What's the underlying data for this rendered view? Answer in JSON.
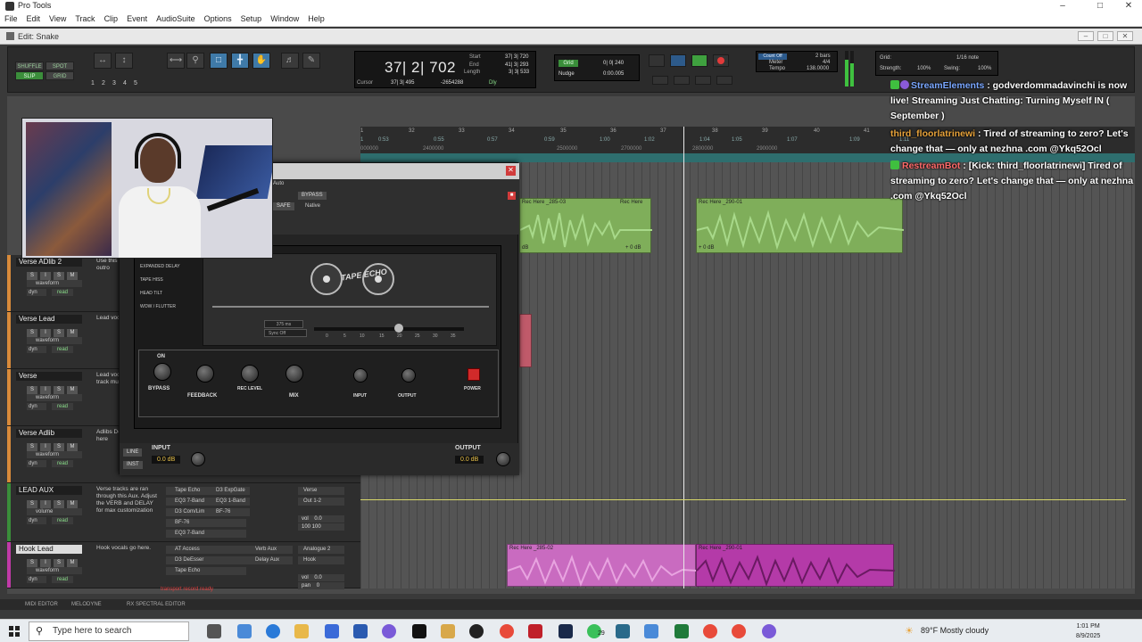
{
  "window": {
    "title": "Pro Tools",
    "edit_title": "Edit: Snake"
  },
  "menu": [
    "File",
    "Edit",
    "View",
    "Track",
    "Clip",
    "Event",
    "AudioSuite",
    "Options",
    "Setup",
    "Window",
    "Help"
  ],
  "toolbar": {
    "modes": [
      "SHUFFLE",
      "SPOT",
      "SLIP",
      "GRID"
    ],
    "zoom_presets": [
      "1",
      "2",
      "3",
      "4",
      "5"
    ],
    "main_counter": "37| 2| 702",
    "start_label": "Start",
    "start_value": "37| 3| 720",
    "end_label": "End",
    "end_value": "41| 3| 293",
    "length_label": "Length",
    "length_value": "3| 3| 533",
    "cursor_label": "Cursor",
    "cursor_value": "37| 3| 495",
    "cursor_sample": "-2654288",
    "dly_label": "Dly",
    "grid_label": "Grid",
    "grid_value": "0| 0| 240",
    "nudge_label": "Nudge",
    "nudge_value": "0:00.005",
    "count_off": "Count Off",
    "bars": "2 bars",
    "meter_label": "Meter",
    "meter_value": "4/4",
    "tempo_label": "Tempo",
    "tempo_value": "138.0000",
    "grid_panel_label": "Grid:",
    "grid_panel_value": "1/16 note",
    "strength_label": "Strength:",
    "strength_value": "100%",
    "swing_label": "Swing:",
    "swing_value": "100%"
  },
  "ruler": {
    "bars": [
      "1",
      "32",
      "33",
      "34",
      "35",
      "36",
      "37",
      "38",
      "39",
      "40",
      "41"
    ],
    "mins": [
      "1",
      "0:53",
      "0:55",
      "0:57",
      "0:59",
      "1:00",
      "1:02",
      "1:04",
      "1:05",
      "1:07",
      "1:09",
      "1:11"
    ],
    "samples": [
      "000000",
      "2400000",
      "2500000",
      "2700000",
      "2800000",
      "2900000"
    ]
  },
  "tracks": [
    {
      "name": "Verse ADlib 2",
      "buttons": [
        "S",
        "I",
        "S",
        "M"
      ],
      "view": "waveform",
      "dyn": "dyn",
      "mode": "read",
      "comment": "Use this filter for the outro",
      "color": "#d88a3a"
    },
    {
      "name": "Verse Lead",
      "buttons": [
        "S",
        "I",
        "S",
        "M"
      ],
      "view": "waveform",
      "dyn": "dyn",
      "mode": "read",
      "comment": "Lead vocal here.",
      "color": "#d88a3a"
    },
    {
      "name": "Verse",
      "buttons": [
        "S",
        "I",
        "S",
        "M"
      ],
      "view": "waveform",
      "dyn": "dyn",
      "mode": "read",
      "comment": "Lead vocal here this track much",
      "color": "#d88a3a"
    },
    {
      "name": "Verse Adlib",
      "buttons": [
        "S",
        "I",
        "S",
        "M"
      ],
      "view": "waveform",
      "dyn": "dyn",
      "mode": "read",
      "comment": "Adlibs Don't here. track here",
      "color": "#d88a3a"
    },
    {
      "name": "LEAD AUX",
      "buttons": [
        "S",
        "I",
        "S",
        "M"
      ],
      "view": "volume",
      "dyn": "dyn",
      "mode": "read",
      "comment": "Verse tracks are ran through this Aux. Adjust the VERB and DELAY for max customization",
      "color": "#3a8e3a",
      "inserts": [
        "Tape Echo",
        "EQ3 7-Band",
        "D3 Com/Lim",
        "BF-76",
        "EQ3 7-Band"
      ],
      "inserts2": [
        "D3 ExpGate",
        "EQ3 1-Band",
        "BF-76"
      ],
      "io": [
        "Verse",
        "Out 1-2"
      ],
      "vol_label": "vol",
      "vol_value": "0.0",
      "pan_value": "100 100"
    },
    {
      "name": "Hook Lead",
      "buttons": [
        "S",
        "I",
        "S",
        "M"
      ],
      "view": "waveform",
      "dyn": "dyn",
      "mode": "read",
      "comment": "Hook vocals go here.",
      "color": "#c03aa8",
      "inserts": [
        "AT Access",
        "D3 DeEsser",
        "Tape Echo"
      ],
      "sends": [
        "Verb Aux",
        "Delay Aux"
      ],
      "io": [
        "Analogue 2",
        "Hook"
      ],
      "vol_label": "vol",
      "vol_value": "0.0",
      "pan_label": "pan",
      "pan_value": "0"
    }
  ],
  "clips": {
    "green1": "Rec Here _285-03",
    "green2": "Rec Here",
    "green3": "Rec Here _290-01",
    "db1": "dB",
    "db2": "+ 0 dB",
    "db3": "+ 0 dB",
    "pink1": "Rec Here _285-02",
    "pink2": "Rec Here _290-01"
  },
  "status_text": "transport record ready",
  "plugin": {
    "auto_label": "Auto",
    "bypass_label": "BYPASS",
    "safe_label": "SAFE",
    "native_label": "Native",
    "logo_word": "TAPE ECHO",
    "side_labels": [
      "EXPANDED DELAY",
      "TAPE HISS",
      "HEAD TILT",
      "WOW / FLUTTER"
    ],
    "delay_time": "375 ms",
    "sync_label": "Sync",
    "sync_value": "Off",
    "scale": [
      "0",
      "5",
      "10",
      "15",
      "20",
      "25",
      "30",
      "35"
    ],
    "on_label": "ON",
    "bypass_knob": "BYPASS",
    "feedback": "FEEDBACK",
    "rec_level": "REC LEVEL",
    "mix": "MIX",
    "input_jack": "INPUT",
    "output_jack": "OUTPUT",
    "power": "POWER",
    "input_label": "INPUT",
    "input_value": "0.0 dB",
    "output_label": "OUTPUT",
    "output_value": "0.0 dB",
    "line_label": "LINE",
    "inst_label": "INST"
  },
  "chat": [
    {
      "user": "StreamElements",
      "text": ": godverdommadavinchi is now live! Streaming Just Chatting: Turning Myself IN ( September )",
      "user_color": "#7aa7ff"
    },
    {
      "user": "third_floorlatrinewi",
      "text": ": Tired of streaming to zero? Let's change that — only at nezhna .com @Ykq52Ocl",
      "user_color": "#e8a33a"
    },
    {
      "user": "RestreamBot",
      "text": ": [Kick: third_floorlatrinewi] Tired of streaming to zero? Let's change that — only at nezhna .com @Ykq52Ocl",
      "user_color": "#ff6b6b"
    }
  ],
  "bottom_tabs": [
    "MIDI EDITOR",
    "MELODYNE",
    "RX SPECTRAL EDITOR"
  ],
  "taskbar": {
    "search_placeholder": "Type here to search",
    "badge": "29",
    "weather": "89°F  Mostly cloudy",
    "time": "1:01 PM",
    "date": "8/9/2025"
  }
}
